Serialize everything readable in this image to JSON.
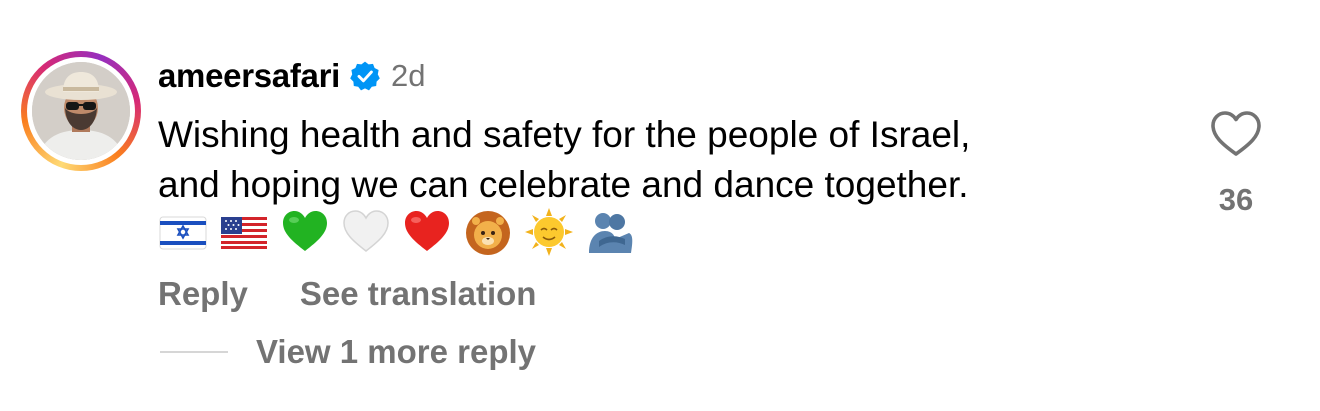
{
  "comment": {
    "username": "ameersafari",
    "verified": true,
    "time": "2d",
    "text_lines": [
      "Wishing health and safety for the people of Israel,",
      "and hoping we can celebrate and dance together."
    ],
    "emojis": [
      "israel-flag-icon",
      "us-flag-icon",
      "green-heart-icon",
      "white-heart-icon",
      "red-heart-icon",
      "lion-icon",
      "sun-with-face-icon",
      "people-hugging-icon"
    ]
  },
  "actions": {
    "reply_label": "Reply",
    "translation_label": "See translation",
    "more_replies_label": "View 1 more reply"
  },
  "like": {
    "count": "36",
    "icon": "heart-outline-icon"
  },
  "colors": {
    "text": "#000000",
    "secondary": "#737373",
    "verified_blue": "#0095f6",
    "divider": "#d6d6d6"
  }
}
